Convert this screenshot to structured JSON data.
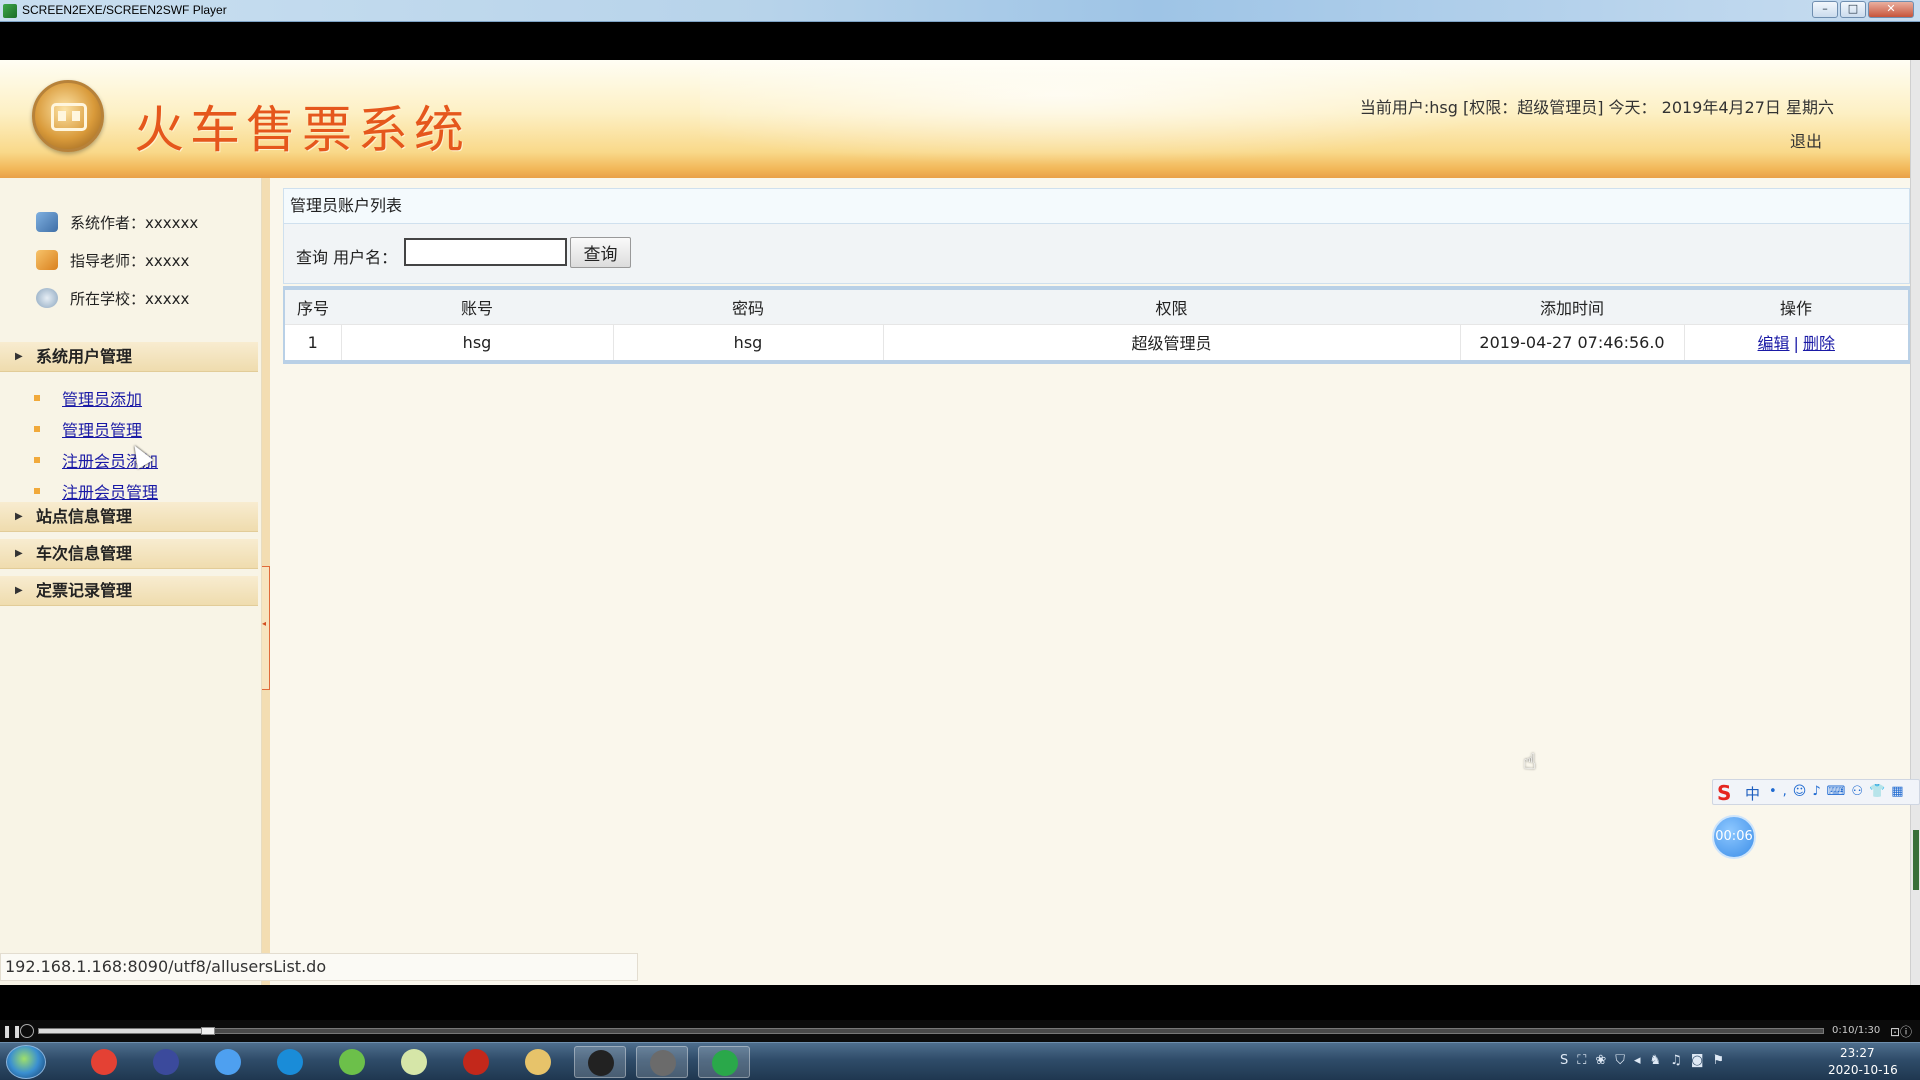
{
  "window": {
    "title": "SCREEN2EXE/SCREEN2SWF Player",
    "min_label": "–",
    "max_label": "□",
    "close_label": "✕"
  },
  "header": {
    "site_title": "火车售票系统",
    "user_info": "当前用户:hsg [权限：超级管理员] 今天： 2019年4月27日 星期六",
    "logout": "退出"
  },
  "sidebar": {
    "profile": [
      {
        "label": "系统作者：xxxxxx"
      },
      {
        "label": "指导老师：xxxxx"
      },
      {
        "label": "所在学校：xxxxx"
      }
    ],
    "menu_users": "系统用户管理",
    "sub_items": [
      "管理员添加",
      "管理员管理",
      "注册会员添加",
      "注册会员管理"
    ],
    "menu_stations": "站点信息管理",
    "menu_trains": "车次信息管理",
    "menu_tickets": "定票记录管理",
    "arrow": "▶"
  },
  "main": {
    "panel_title": "管理员账户列表",
    "query_label": "查询 用户名：",
    "search_value": "",
    "search_button": "查询",
    "columns": [
      "序号",
      "账号",
      "密码",
      "权限",
      "添加时间",
      "操作"
    ],
    "rows": [
      {
        "index": "1",
        "account": "hsg",
        "password": "hsg",
        "role": "超级管理员",
        "added": "2019-04-27 07:46:56.0",
        "edit": "编辑",
        "sep": "|",
        "delete": "删除"
      }
    ]
  },
  "status_bar": {
    "url": "192.168.1.168:8090/utf8/allusersList.do"
  },
  "overlay": {
    "ime_logo": "S",
    "ime_mode": "中",
    "ime_icons": "•,☺♪⌨⚇👕▦",
    "timer": "00:06"
  },
  "player": {
    "time": "0:10/1:30",
    "progress": 0.095,
    "pause": "❚❚",
    "ctrls": "⊡ⓘ"
  },
  "taskbar": {
    "apps": [
      {
        "name": "chrome",
        "color": "#e44134"
      },
      {
        "name": "media-player",
        "color": "#3b4a9c"
      },
      {
        "name": "baidu-netdisk",
        "color": "#4ea0f0"
      },
      {
        "name": "browser-q",
        "color": "#1a8cd8"
      },
      {
        "name": "leaf-app",
        "color": "#6cc04a"
      },
      {
        "name": "chart-app",
        "color": "#d6e6a8"
      },
      {
        "name": "flash",
        "color": "#c3281b"
      },
      {
        "name": "file-explorer",
        "color": "#e7c36a"
      },
      {
        "name": "qq",
        "color": "#222222"
      },
      {
        "name": "avatar-app",
        "color": "#6b6b6b"
      },
      {
        "name": "screen2exe",
        "color": "#2aa84a"
      }
    ],
    "tray_icons": "S⛶❀⛉◂♞♫◙⚑",
    "time": "23:27",
    "date": "2020-10-16"
  },
  "colors": {
    "title_orange": "#e5571c",
    "link_blue": "#1a1aa6",
    "header_gold": "#f2b85a"
  }
}
